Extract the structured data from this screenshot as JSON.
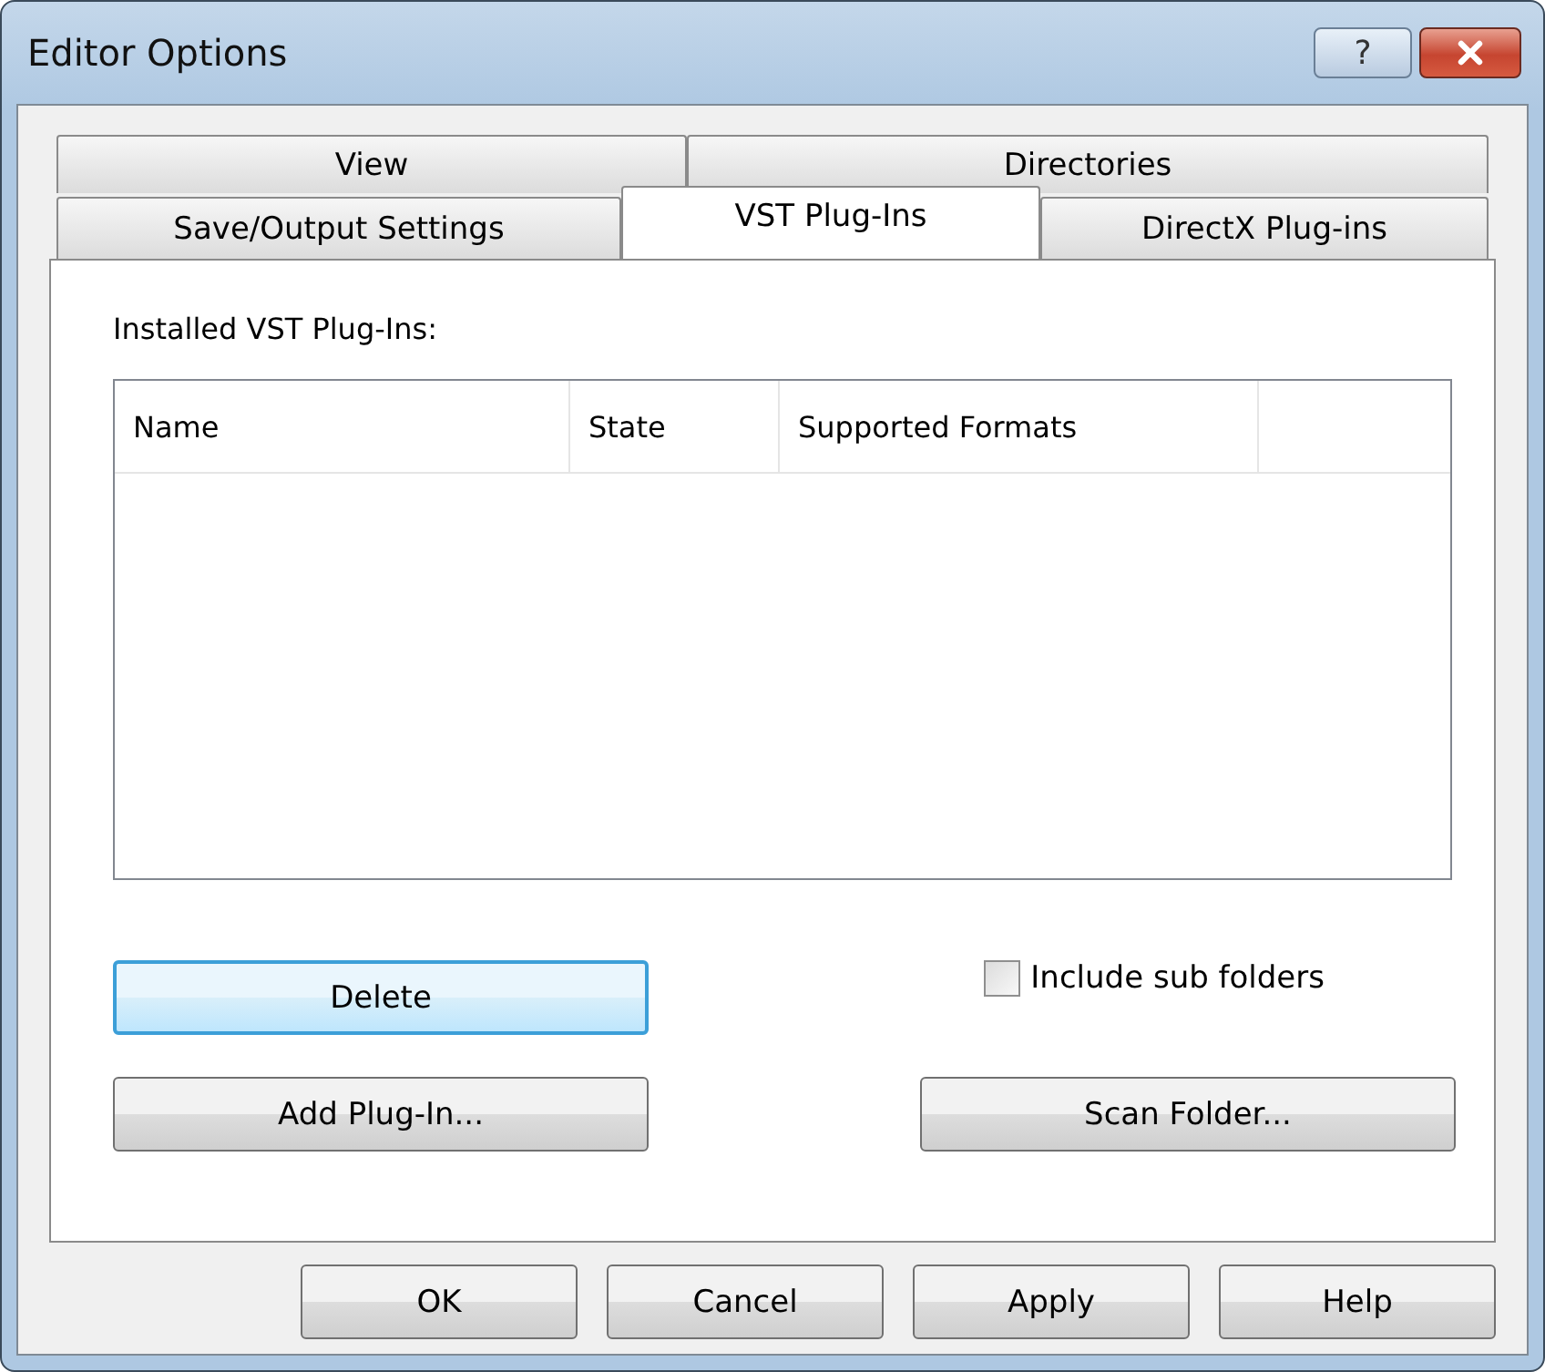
{
  "window": {
    "title": "Editor Options",
    "help_glyph": "?"
  },
  "tab_rows": [
    {
      "tabs": [
        {
          "label": "View",
          "selected": false
        },
        {
          "label": "Directories",
          "selected": false
        }
      ]
    },
    {
      "tabs": [
        {
          "label": "Save/Output Settings",
          "selected": false
        },
        {
          "label": "VST Plug-Ins",
          "selected": true
        },
        {
          "label": "DirectX Plug-ins",
          "selected": false
        }
      ]
    }
  ],
  "list": {
    "label": "Installed VST Plug-Ins:",
    "columns": [
      "Name",
      "State",
      "Supported Formats"
    ]
  },
  "delete_button": {
    "label": "Delete",
    "focused": true
  },
  "include_sub_folders": {
    "label": "Include sub folders",
    "checked": false
  },
  "add_button": {
    "label": "Add Plug-In..."
  },
  "scan_button": {
    "label": "Scan Folder..."
  },
  "dialog_buttons": [
    "OK",
    "Cancel",
    "Apply",
    "Help"
  ]
}
